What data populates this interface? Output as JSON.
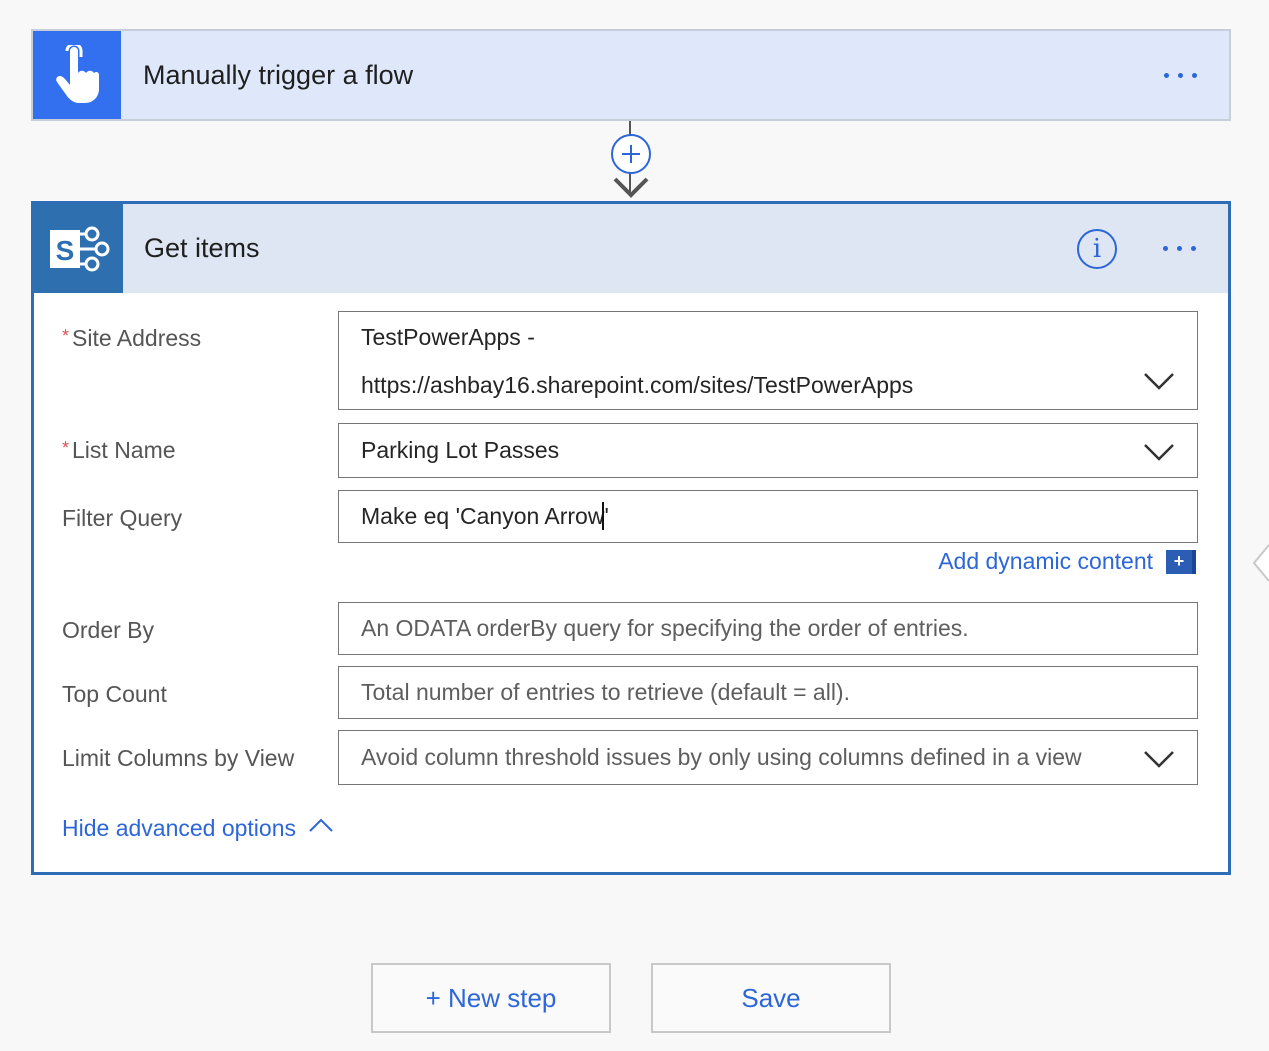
{
  "trigger": {
    "title": "Manually trigger a flow",
    "icon": "touch-hand-icon",
    "accent": "#3370ef"
  },
  "action": {
    "title": "Get items",
    "icon": "sharepoint-icon",
    "accent": "#2e6fb0",
    "info_glyph": "i",
    "fields": {
      "site_address": {
        "label": "Site Address",
        "required_mark": "*",
        "value_line1": "TestPowerApps -",
        "value_line2": "https://ashbay16.sharepoint.com/sites/TestPowerApps"
      },
      "list_name": {
        "label": "List Name",
        "required_mark": "*",
        "value": "Parking Lot Passes"
      },
      "filter_query": {
        "label": "Filter Query",
        "value": "Make eq 'Canyon Arrow",
        "value_tail": "'"
      },
      "order_by": {
        "label": "Order By",
        "placeholder": "An ODATA orderBy query for specifying the order of entries."
      },
      "top_count": {
        "label": "Top Count",
        "placeholder": "Total number of entries to retrieve (default = all)."
      },
      "limit_columns": {
        "label": "Limit Columns by View",
        "placeholder": "Avoid column threshold issues by only using columns defined in a view"
      }
    },
    "add_dynamic_content": "Add dynamic content",
    "add_dynamic_plus": "+",
    "hide_advanced": "Hide advanced options"
  },
  "buttons": {
    "new_step": "+ New step",
    "save": "Save"
  },
  "colors": {
    "link_blue": "#2c66d8",
    "card_border": "#2f6db6",
    "required_red": "#d9534f"
  }
}
